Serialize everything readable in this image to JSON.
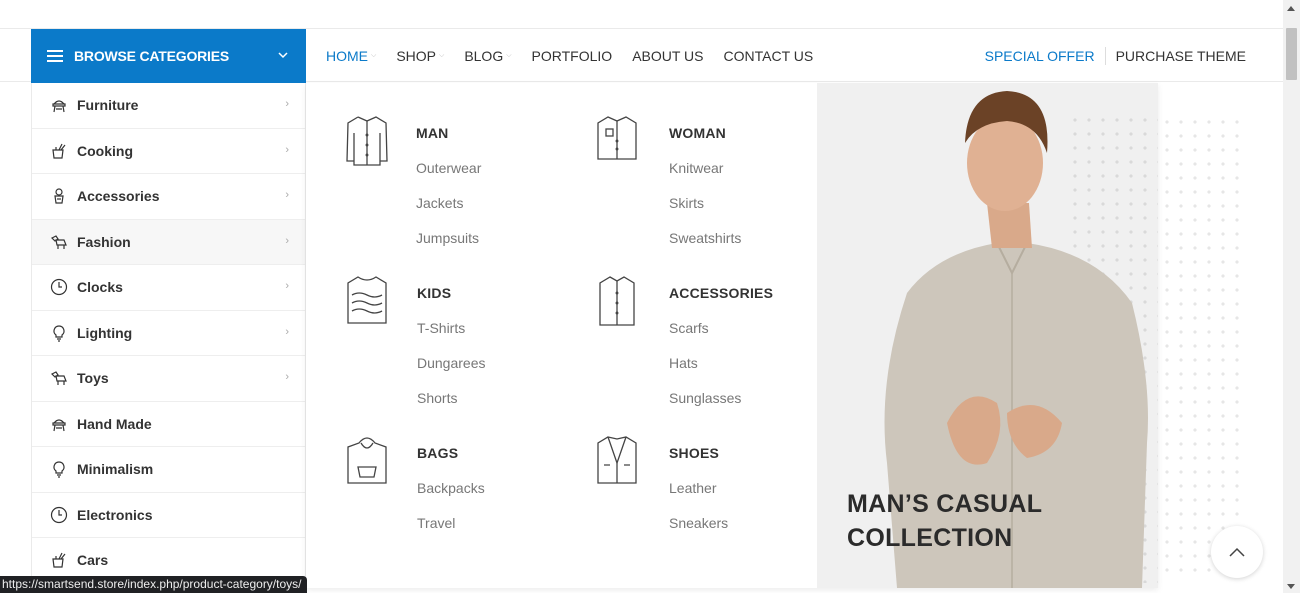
{
  "header": {
    "browse_label": "BROWSE CATEGORIES",
    "nav": [
      {
        "label": "HOME",
        "active": true,
        "has_dropdown": true
      },
      {
        "label": "SHOP",
        "active": false,
        "has_dropdown": true
      },
      {
        "label": "BLOG",
        "active": false,
        "has_dropdown": true
      },
      {
        "label": "PORTFOLIO",
        "active": false,
        "has_dropdown": false
      },
      {
        "label": "ABOUT US",
        "active": false,
        "has_dropdown": false
      },
      {
        "label": "CONTACT US",
        "active": false,
        "has_dropdown": false
      }
    ],
    "special_offer": "SPECIAL OFFER",
    "purchase_theme": "PURCHASE THEME"
  },
  "sidebar": {
    "items": [
      {
        "label": "Furniture",
        "icon": "chair-icon",
        "has_submenu": true
      },
      {
        "label": "Cooking",
        "icon": "cooking-icon",
        "has_submenu": true
      },
      {
        "label": "Accessories",
        "icon": "accessories-icon",
        "has_submenu": true
      },
      {
        "label": "Fashion",
        "icon": "fashion-icon",
        "has_submenu": true,
        "hovered": true
      },
      {
        "label": "Clocks",
        "icon": "clock-icon",
        "has_submenu": true
      },
      {
        "label": "Lighting",
        "icon": "bulb-icon",
        "has_submenu": true
      },
      {
        "label": "Toys",
        "icon": "toy-horse-icon",
        "has_submenu": true
      },
      {
        "label": "Hand Made",
        "icon": "chair-icon",
        "has_submenu": false
      },
      {
        "label": "Minimalism",
        "icon": "bulb-icon",
        "has_submenu": false
      },
      {
        "label": "Electronics",
        "icon": "clock-icon",
        "has_submenu": false
      },
      {
        "label": "Cars",
        "icon": "cooking-icon",
        "has_submenu": false
      }
    ]
  },
  "mega_menu": {
    "groups": [
      {
        "title": "MAN",
        "icon": "shirt-icon",
        "links": [
          "Outerwear",
          "Jackets",
          "Jumpsuits"
        ]
      },
      {
        "title": "WOMAN",
        "icon": "blouse-icon",
        "links": [
          "Knitwear",
          "Skirts",
          "Sweatshirts"
        ]
      },
      {
        "title": "KIDS",
        "icon": "sweater-icon",
        "links": [
          "T-Shirts",
          "Dungarees",
          "Shorts"
        ]
      },
      {
        "title": "ACCESSORIES",
        "icon": "shirt-icon",
        "links": [
          "Scarfs",
          "Hats",
          "Sunglasses"
        ]
      },
      {
        "title": "BAGS",
        "icon": "hoodie-icon",
        "links": [
          "Backpacks",
          "Travel"
        ]
      },
      {
        "title": "SHOES",
        "icon": "jacket-icon",
        "links": [
          "Leather",
          "Sneakers"
        ]
      }
    ],
    "promo": {
      "title_line1": "MAN’S CASUAL",
      "title_line2": "COLLECTION"
    }
  },
  "status_url": "https://smartsend.store/index.php/product-category/toys/",
  "colors": {
    "accent": "#0b7ac9",
    "text": "#333333",
    "muted": "#777777"
  }
}
